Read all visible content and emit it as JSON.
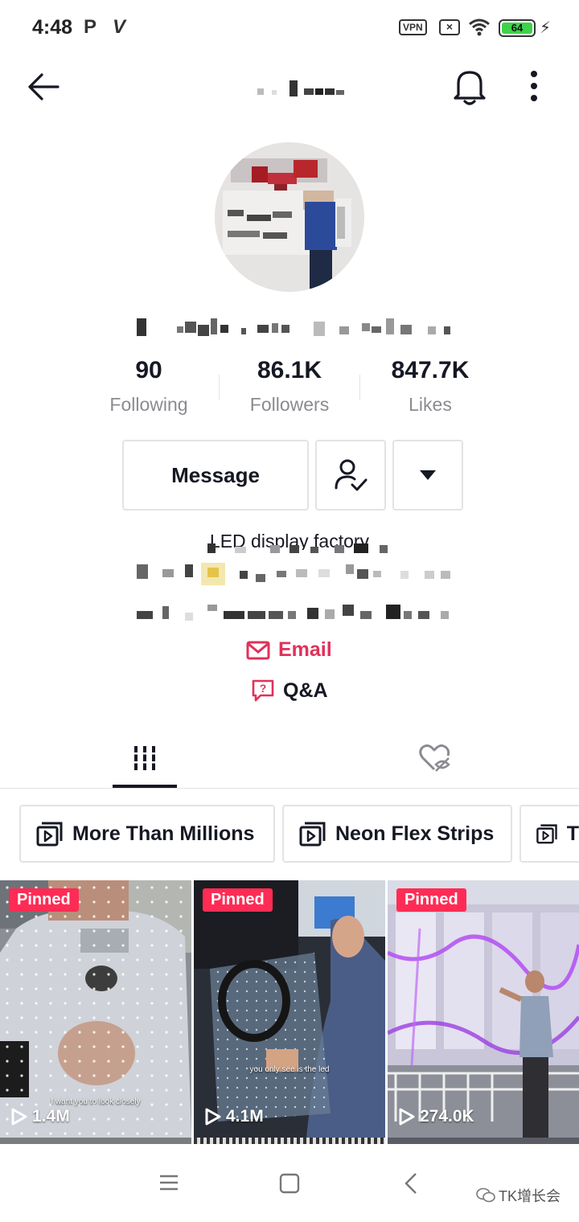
{
  "status_bar": {
    "time": "4:48",
    "app_icon_1": "P",
    "app_icon_2": "V",
    "vpn": "VPN",
    "battery": "64"
  },
  "profile": {
    "stats": [
      {
        "value": "90",
        "label": "Following"
      },
      {
        "value": "86.1K",
        "label": "Followers"
      },
      {
        "value": "847.7K",
        "label": "Likes"
      }
    ],
    "message_button": "Message",
    "bio": "LED display factory",
    "email_label": "Email",
    "qa_label": "Q&A"
  },
  "playlists": [
    {
      "label": "More Than Millions"
    },
    {
      "label": "Neon Flex Strips"
    },
    {
      "label": "T"
    }
  ],
  "videos": [
    {
      "pinned": "Pinned",
      "views": "1.4M",
      "caption": "I want you to look closely"
    },
    {
      "pinned": "Pinned",
      "views": "4.1M",
      "caption": "you only see is the led"
    },
    {
      "pinned": "Pinned",
      "views": "274.0K",
      "caption": ""
    }
  ],
  "watermark": "TK增长会",
  "colors": {
    "accent": "#fe2c55",
    "email": "#e1305a",
    "text": "#161823",
    "secondary": "#8a8b91"
  }
}
